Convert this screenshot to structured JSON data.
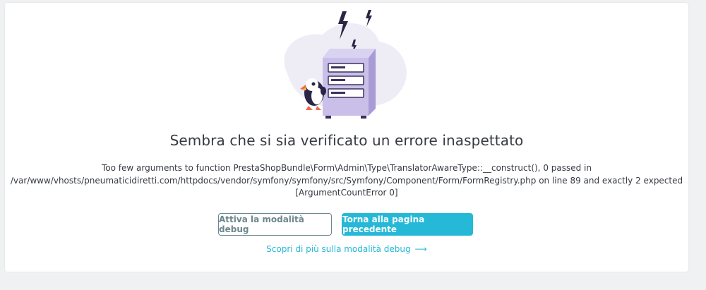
{
  "error": {
    "title": "Sembra che si sia verificato un errore inaspettato",
    "message_lines": [
      "Too few arguments to function PrestaShopBundle\\Form\\Admin\\Type\\TranslatorAwareType::__construct(), 0 passed in",
      "/var/www/vhosts/pneumaticidiretti.com/httpdocs/vendor/symfony/symfony/src/Symfony/Component/Form/FormRegistry.php on line 89 and exactly 2 expected",
      "[ArgumentCountError 0]"
    ]
  },
  "actions": {
    "debug_button_label": "Attiva la modalità debug",
    "back_button_label": "Torna alla pagina precedente",
    "learn_more_label": "Scopri di più sulla modalità debug",
    "learn_more_arrow": "⟶"
  },
  "illustration": {
    "icon": "server-error-puffin-illustration"
  },
  "colors": {
    "accent": "#25b9d7",
    "secondary": "#6c868e",
    "text": "#363a41",
    "background": "#eff1f2",
    "server": "#c9bfe8"
  }
}
